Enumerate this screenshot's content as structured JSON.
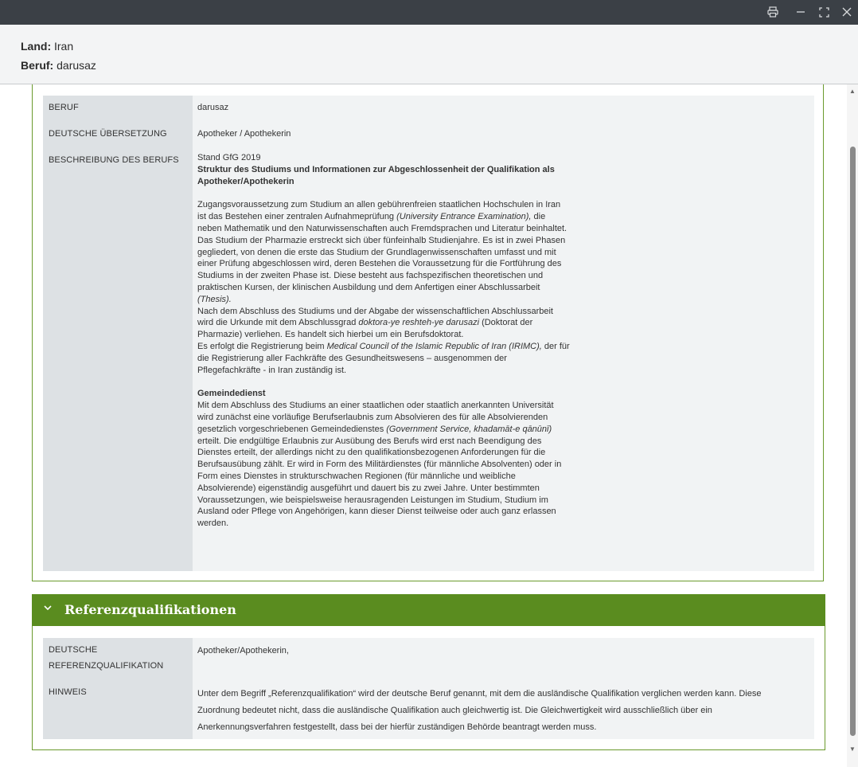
{
  "header": {
    "land_label": "Land:",
    "land_value": "Iran",
    "beruf_label": "Beruf:",
    "beruf_value": "darusaz"
  },
  "window_icons": [
    "print-icon",
    "minimize-icon",
    "maximize-icon",
    "close-icon"
  ],
  "profession": {
    "rows": [
      {
        "label": "BERUF",
        "value": "darusaz"
      },
      {
        "label": "DEUTSCHE ÜBERSETZUNG",
        "value": "Apotheker / Apothekerin"
      },
      {
        "label": "BESCHREIBUNG DES BERUFS"
      }
    ],
    "description": {
      "stand": "Stand GfG 2019",
      "heading": "Struktur des Studiums und Informationen zur Abgeschlossenheit der Qualifikation als Apotheker/Apothekerin",
      "p1_a": "Zugangsvoraussetzung zum Studium an allen gebührenfreien staatlichen Hochschulen in Iran ist das Bestehen einer zentralen Aufnahmeprüfung",
      "p1_i": "(University Entrance Examination),",
      "p1_b": "die neben Mathematik und den Naturwissenschaften auch Fremdsprachen und Literatur beinhaltet.",
      "p2_a": "Das Studium der Pharmazie erstreckt sich über fünfeinhalb Studienjahre. Es ist in zwei Phasen gegliedert, von denen die erste das Studium der Grundlagenwissenschaften umfasst und mit einer Prüfung abgeschlossen wird, deren Bestehen die Voraussetzung für die Fortführung des Studiums in der zweiten Phase ist. Diese besteht aus fachspezifischen theoretischen und praktischen Kursen, der klinischen Ausbildung und dem Anfertigen einer Abschlussarbeit",
      "p2_i": "(Thesis).",
      "p3_a": "Nach dem Abschluss des Studiums und der Abgabe der wissenschaftlichen Abschlussarbeit wird die Urkunde mit dem Abschlussgrad",
      "p3_i": "doktora-ye reshteh-ye darusazi",
      "p3_b": "(Doktorat der Pharmazie) verliehen. Es handelt sich hierbei um ein Berufsdoktorat.",
      "p4_a": "Es erfolgt die Registrierung beim",
      "p4_i": "Medical Council of the Islamic Republic of Iran (IRIMC),",
      "p4_b": "der für die Registrierung aller Fachkräfte des Gesundheitswesens – ausgenommen der Pflegefachkräfte - in Iran zuständig ist.",
      "heading2": "Gemeindedienst",
      "p5_a": "Mit dem Abschluss des Studiums an einer staatlichen oder staatlich anerkannten Universität wird zunächst eine vorläufige Berufserlaubnis zum Absolvieren des für alle Absolvierenden gesetzlich vorgeschriebenen Gemeindedienstes",
      "p5_i": "(Government Service, khadamāt-e qānūnī)",
      "p5_b": "erteilt. Die endgültige Erlaubnis zur Ausübung des Berufs wird erst nach Beendigung des Dienstes erteilt, der allerdings nicht zu den qualifikationsbezogenen Anforderungen für die Berufsausübung zählt. Er wird in Form des Militärdienstes (für männliche Absolventen) oder in Form eines Dienstes in strukturschwachen Regionen (für männliche und weibliche Absolvierende) eigenständig ausgeführt und dauert bis zu zwei Jahre. Unter bestimmten Voraussetzungen, wie beispielsweise herausragenden Leistungen im Studium, Studium im Ausland oder Pflege von Angehörigen, kann dieser Dienst teilweise oder auch ganz erlassen werden."
    }
  },
  "reference": {
    "section_title": "Referenzqualifikationen",
    "rows": [
      {
        "label_line1": "DEUTSCHE",
        "label_line2": "REFERENZQUALIFIKATION",
        "value": "Apotheker/Apothekerin,"
      },
      {
        "label": "HINWEIS",
        "value": "Unter dem Begriff „Referenzqualifikation“ wird der deutsche Beruf genannt, mit dem die ausländische Qualifikation verglichen werden kann. Diese Zuordnung bedeutet nicht, dass die ausländische Qualifikation auch gleichwertig ist. Die Gleichwertigkeit wird ausschließlich über ein Anerkennungsverfahren festgestellt, dass bei der hierfür zuständigen Behörde beantragt werden muss."
      }
    ]
  }
}
